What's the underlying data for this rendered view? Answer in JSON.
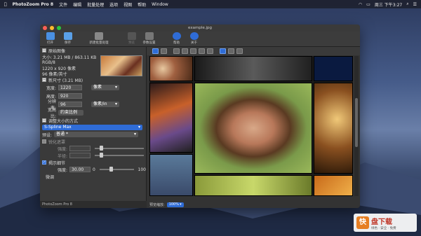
{
  "menubar": {
    "app": "PhotoZoom Pro 8",
    "items": [
      "文件",
      "编辑",
      "批量处理",
      "选项",
      "视图",
      "帮助",
      "Window"
    ],
    "clock": "周三 下午3:27"
  },
  "window": {
    "title": "example.jpg"
  },
  "toolbar": {
    "items": [
      {
        "label": "打开",
        "icon": "open-folder-icon"
      },
      {
        "label": "保存",
        "icon": "save-icon"
      },
      {
        "label": "新建批量处理",
        "icon": "batch-stack-icon"
      },
      {
        "label": "预览",
        "icon": "preview-icon"
      },
      {
        "label": "参数设置",
        "icon": "settings-tools-icon"
      },
      {
        "label": "帮助",
        "icon": "help-icon"
      },
      {
        "label": "关于",
        "icon": "info-icon"
      }
    ]
  },
  "panel": {
    "original_heading": "原始图像",
    "size_line": "大小: 3.21 MB / 863.11 KB",
    "color_mode": "RGB/8",
    "dimensions": "1220 x 920 像素",
    "resolution": "96 像素/英寸",
    "new_size_heading": "新尺寸 (3.21 MB)",
    "width_label": "宽度:",
    "width_value": "1220",
    "width_unit": "像素",
    "height_label": "高度:",
    "height_value": "920",
    "res_label": "分辨率:",
    "res_value": "96",
    "res_unit": "像素/in",
    "ratio_label": "宽高比:",
    "ratio_value": "约束比例",
    "resize_heading": "调整大小的方式",
    "method": "S-Spline Max",
    "preset_label": "预设:",
    "preset_value": "普通 *",
    "sharpen_label": "锐化遮罩",
    "strength_label": "强度:",
    "radius_label": "半径:",
    "detail_label": "揭示细节",
    "detail_strength_label": "强度:",
    "detail_strength_value": "30.00",
    "detail_min": "0",
    "detail_max": "100",
    "fine_label": "微调"
  },
  "footer": {
    "text": "PhotoZoom Pro 8"
  },
  "zoombar": {
    "label": "预览缩放:",
    "value": "100%"
  },
  "watermark": {
    "logo": "快",
    "title": "盘下载",
    "sub": "绿色 · 安全 · 免费"
  },
  "colors": {
    "accent": "#2f6cd6",
    "close": "#ff5f57",
    "min": "#febc2e",
    "max": "#28c840"
  }
}
